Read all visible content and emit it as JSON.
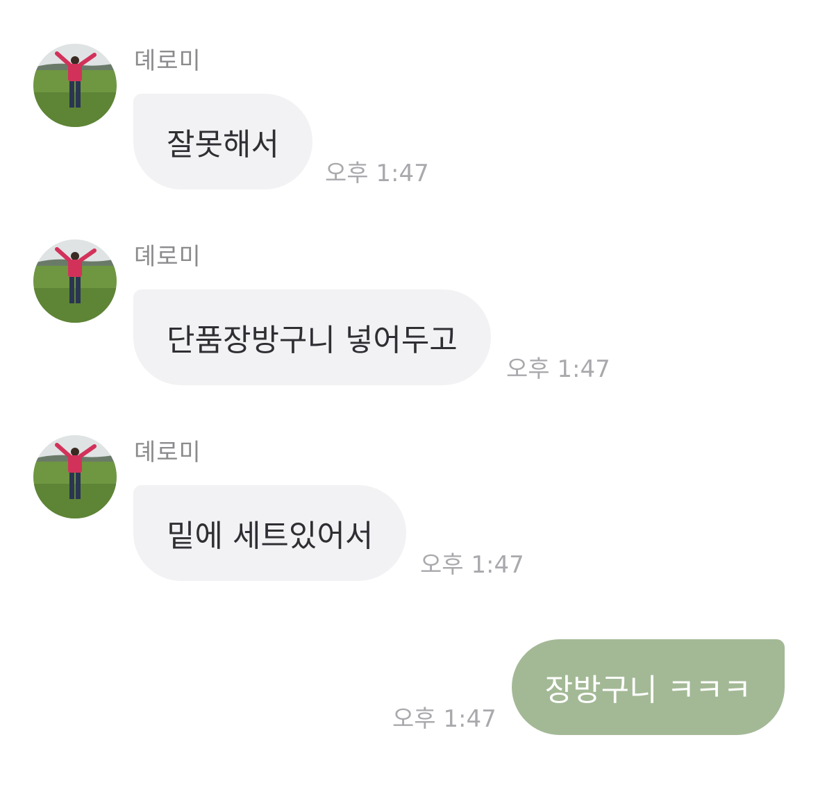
{
  "messages": [
    {
      "sender": "뎨로미",
      "text": "잘못해서",
      "time": "오후 1:47",
      "direction": "incoming"
    },
    {
      "sender": "뎨로미",
      "text": "단품장방구니 넣어두고",
      "time": "오후 1:47",
      "direction": "incoming"
    },
    {
      "sender": "뎨로미",
      "text": "밑에 세트있어서",
      "time": "오후 1:47",
      "direction": "incoming"
    },
    {
      "text": "장방구니 ㅋㅋㅋ",
      "time": "오후 1:47",
      "direction": "outgoing"
    }
  ],
  "colors": {
    "incoming_bubble": "#f2f2f4",
    "outgoing_bubble": "#a3b996",
    "timestamp": "#a9a9ad",
    "sender_name": "#8b8b8e"
  }
}
